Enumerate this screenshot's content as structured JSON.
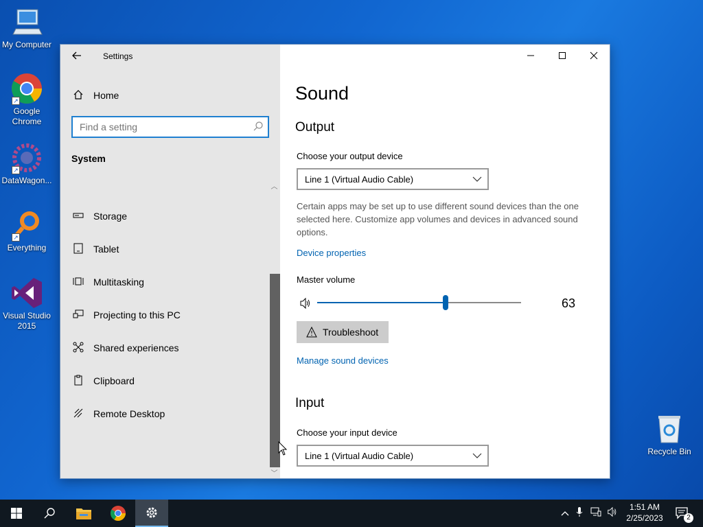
{
  "desktop": {
    "icons": [
      {
        "label": "My Computer",
        "icon": "computer-icon"
      },
      {
        "label": "Google Chrome",
        "icon": "chrome-icon"
      },
      {
        "label": "DataWagon...",
        "icon": "datawagon-icon"
      },
      {
        "label": "Everything",
        "icon": "everything-search-icon"
      },
      {
        "label": "Visual Studio 2015",
        "icon": "visual-studio-icon"
      },
      {
        "label": "Recycle Bin",
        "icon": "recycle-bin-icon"
      }
    ]
  },
  "window": {
    "title": "Settings",
    "controls": {
      "minimize": "minimize-icon",
      "maximize": "maximize-icon",
      "close": "close-icon"
    }
  },
  "nav": {
    "home_label": "Home",
    "search": {
      "placeholder": "Find a setting",
      "value": ""
    },
    "section": "System",
    "items": [
      {
        "label": "Storage",
        "icon": "storage-icon"
      },
      {
        "label": "Tablet",
        "icon": "tablet-icon"
      },
      {
        "label": "Multitasking",
        "icon": "multitasking-icon"
      },
      {
        "label": "Projecting to this PC",
        "icon": "projecting-icon"
      },
      {
        "label": "Shared experiences",
        "icon": "shared-experiences-icon"
      },
      {
        "label": "Clipboard",
        "icon": "clipboard-icon"
      },
      {
        "label": "Remote Desktop",
        "icon": "remote-desktop-icon"
      }
    ]
  },
  "sound": {
    "title": "Sound",
    "output": {
      "heading": "Output",
      "device_label": "Choose your output device",
      "device_value": "Line 1 (Virtual Audio Cable)",
      "description": "Certain apps may be set up to use different sound devices than the one selected here. Customize app volumes and devices in advanced sound options.",
      "device_properties_link": "Device properties",
      "master_volume_label": "Master volume",
      "volume": 63,
      "troubleshoot_label": "Troubleshoot",
      "manage_link": "Manage sound devices"
    },
    "input": {
      "heading": "Input",
      "device_label": "Choose your input device",
      "device_value": "Line 1 (Virtual Audio Cable)"
    }
  },
  "taskbar": {
    "time": "1:51 AM",
    "date": "2/25/2023",
    "notification_count": "2",
    "accent": "#76b9ed"
  }
}
